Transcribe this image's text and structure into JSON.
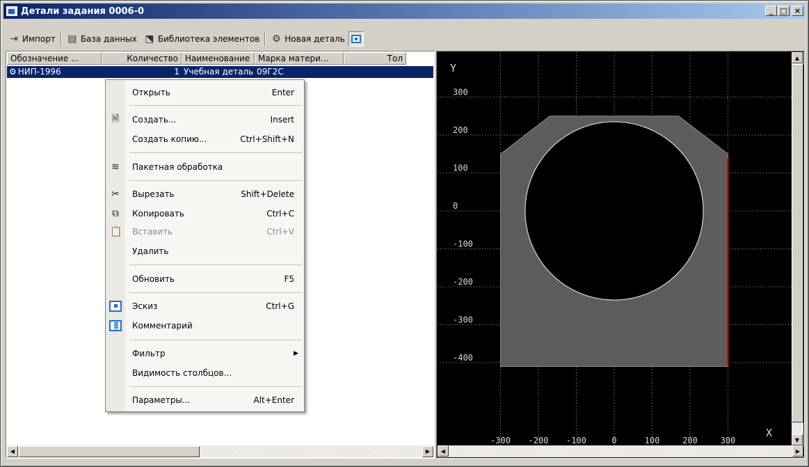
{
  "window": {
    "title": "Детали задания 0006-0",
    "buttons": [
      "_",
      "□",
      "×"
    ]
  },
  "toolbar": {
    "import": "Импорт",
    "database": "База данных",
    "library": "Библиотека элементов",
    "new_part": "Новая деталь"
  },
  "list": {
    "columns": [
      "Обозначение ...",
      "Количество",
      "Наименование",
      "Марка матери...",
      "Тол"
    ],
    "rows": [
      {
        "designation": "НИП-1996",
        "quantity": "1",
        "name": "Учебная деталь",
        "material": "09Г2С",
        "thickness": ""
      }
    ]
  },
  "context_menu": {
    "items": [
      {
        "label": "Открыть",
        "shortcut": "Enter",
        "icon": ""
      },
      {
        "label": "Создать...",
        "shortcut": "Insert",
        "icon": "new-document-icon"
      },
      {
        "label": "Создать копию...",
        "shortcut": "Ctrl+Shift+N",
        "icon": ""
      },
      {
        "label": "Пакетная обработка",
        "shortcut": "",
        "icon": "batch-layers-icon"
      },
      {
        "label": "Вырезать",
        "shortcut": "Shift+Delete",
        "icon": "scissors-icon"
      },
      {
        "label": "Копировать",
        "shortcut": "Ctrl+C",
        "icon": "copy-icon"
      },
      {
        "label": "Вставить",
        "shortcut": "Ctrl+V",
        "icon": "paste-icon",
        "disabled": true
      },
      {
        "label": "Удалить",
        "shortcut": "",
        "icon": ""
      },
      {
        "label": "Обновить",
        "shortcut": "F5",
        "icon": ""
      },
      {
        "label": "Эскиз",
        "shortcut": "Ctrl+G",
        "icon": "sketch-icon"
      },
      {
        "label": "Комментарий",
        "shortcut": "",
        "icon": "comment-icon"
      },
      {
        "label": "Фильтр",
        "shortcut": "",
        "icon": "",
        "submenu": true
      },
      {
        "label": "Видимость столбцов...",
        "shortcut": "",
        "icon": ""
      },
      {
        "label": "Параметры...",
        "shortcut": "Alt+Enter",
        "icon": ""
      }
    ]
  },
  "canvas": {
    "x_ticks": [
      "-300",
      "-200",
      "-100",
      "0",
      "100",
      "200",
      "300"
    ],
    "y_ticks": [
      "300",
      "200",
      "100",
      "0",
      "-100",
      "-200",
      "-300",
      "-400"
    ],
    "x_axis_label": "X",
    "y_axis_label": "Y",
    "background": "#000000",
    "part_fill": "#5a5d59",
    "hole_fill": "#000000",
    "edge_highlight": "#c00000",
    "grid_color": "#9a9a9a"
  }
}
